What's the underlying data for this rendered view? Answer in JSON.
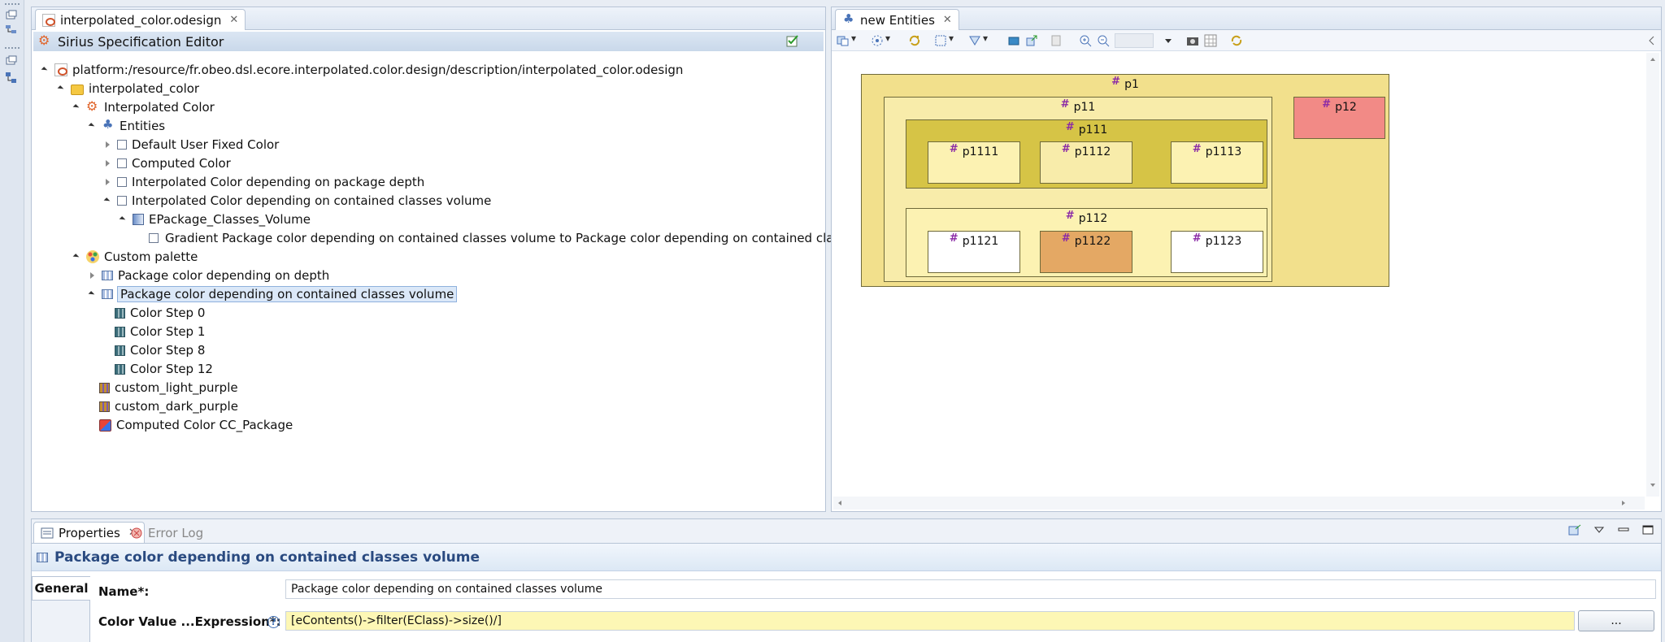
{
  "editor": {
    "tab_label": "interpolated_color.odesign",
    "header_title": "Sirius Specification Editor",
    "tree": [
      {
        "label": "platform:/resource/fr.obeo.dsl.ecore.interpolated.color.design/description/interpolated_color.odesign",
        "icon": "odesign-file-icon"
      },
      {
        "label": "interpolated_color",
        "icon": "folder-icon"
      },
      {
        "label": "Interpolated Color",
        "icon": "viewpoint-icon"
      },
      {
        "label": "Entities",
        "icon": "diagram-description-icon"
      },
      {
        "label": "Default User Fixed Color",
        "icon": "style-icon"
      },
      {
        "label": "Computed Color",
        "icon": "style-icon"
      },
      {
        "label": "Interpolated Color depending on package depth",
        "icon": "style-icon"
      },
      {
        "label": "Interpolated Color depending on contained classes volume",
        "icon": "style-icon"
      },
      {
        "label": "EPackage_Classes_Volume",
        "icon": "gradient-icon"
      },
      {
        "label": "Gradient Package color depending on contained classes volume to Package color depending on contained classes volume",
        "icon": "gradient-link-icon"
      },
      {
        "label": "Custom palette",
        "icon": "palette-icon"
      },
      {
        "label": "Package color depending on depth",
        "icon": "package-color-icon"
      },
      {
        "label": "Package color depending on contained classes volume",
        "icon": "package-color-icon"
      },
      {
        "label": "Color Step 0",
        "icon": "color-step-icon"
      },
      {
        "label": "Color Step 1",
        "icon": "color-step-icon"
      },
      {
        "label": "Color Step 8",
        "icon": "color-step-icon"
      },
      {
        "label": "Color Step 12",
        "icon": "color-step-icon"
      },
      {
        "label": "custom_light_purple",
        "icon": "custom-color-icon"
      },
      {
        "label": "custom_dark_purple",
        "icon": "custom-color-icon"
      },
      {
        "label": "Computed Color CC_Package",
        "icon": "computed-color-icon"
      }
    ]
  },
  "diagram": {
    "tab_label": "new Entities",
    "packages": [
      {
        "label": "p1",
        "color": "#f2e08c"
      },
      {
        "label": "p11",
        "color": "#f8ecaa"
      },
      {
        "label": "p12",
        "color": "#f28a86"
      },
      {
        "label": "p111",
        "color": "#d6c446"
      },
      {
        "label": "p1111",
        "color": "#fcf2b2"
      },
      {
        "label": "p1112",
        "color": "#f8ecaa"
      },
      {
        "label": "p1113",
        "color": "#fcf2b2"
      },
      {
        "label": "p112",
        "color": "#fcf2b2"
      },
      {
        "label": "p1121",
        "color": "#ffffff"
      },
      {
        "label": "p1122",
        "color": "#e4a864"
      },
      {
        "label": "p1123",
        "color": "#ffffff"
      }
    ]
  },
  "properties": {
    "tab_label": "Properties",
    "errorlog_label": "Error Log",
    "title": "Package color depending on contained classes volume",
    "general_tab": "General",
    "name_label": "Name*:",
    "name_value": "Package color depending on contained classes volume",
    "expr_label": "Color Value ...Expression*:",
    "expr_value": "[eContents()->filter(EClass)->size()/]",
    "dots_label": "..."
  }
}
